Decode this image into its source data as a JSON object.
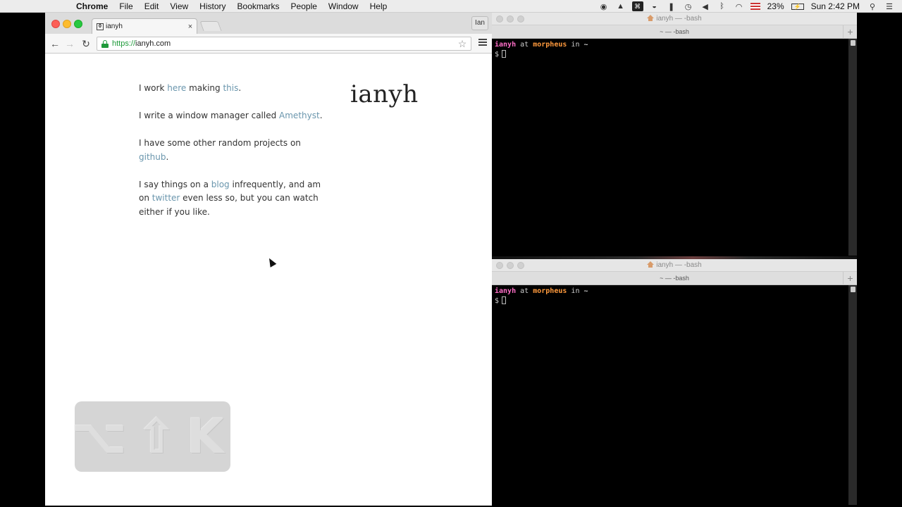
{
  "menubar": {
    "apple": "",
    "items": [
      "Chrome",
      "File",
      "Edit",
      "View",
      "History",
      "Bookmarks",
      "People",
      "Window",
      "Help"
    ],
    "battery": "23%",
    "clock": "Sun 2:42 PM"
  },
  "chrome": {
    "tab_title": "ianyh",
    "tab_close": "×",
    "favicon": "0",
    "profile": "Ian",
    "url_scheme": "https://",
    "url_host": "ianyh.com",
    "star": "☆"
  },
  "page": {
    "logo": "ianyh",
    "p1": {
      "t1": "I work ",
      "link1": "here",
      "t2": " making ",
      "link2": "this",
      "t3": "."
    },
    "p2": {
      "t1": "I write a window manager called ",
      "link1": "Amethyst",
      "t2": "."
    },
    "p3": {
      "t1": "I have some other random projects on ",
      "link1": "github",
      "t2": "."
    },
    "p4": {
      "t1": "I say things on a ",
      "link1": "blog",
      "t2": " infrequently, and am on ",
      "link2": "twitter",
      "t3": " even less so, but you can watch either if you like."
    },
    "keycast": "⌥⇧K"
  },
  "terminal_top": {
    "title": "ianyh — -bash",
    "tab": "~ — -bash",
    "new_tab": "+",
    "prompt_user": "ianyh",
    "prompt_at": "at",
    "prompt_host": "morpheus",
    "prompt_in": "in",
    "prompt_path": "~",
    "prompt_symbol": "$"
  },
  "terminal_bottom": {
    "title": "ianyh — -bash",
    "tab": "~ — -bash",
    "new_tab": "+",
    "prompt_user": "ianyh",
    "prompt_at": "at",
    "prompt_host": "morpheus",
    "prompt_in": "in",
    "prompt_path": "~",
    "prompt_symbol": "$"
  }
}
